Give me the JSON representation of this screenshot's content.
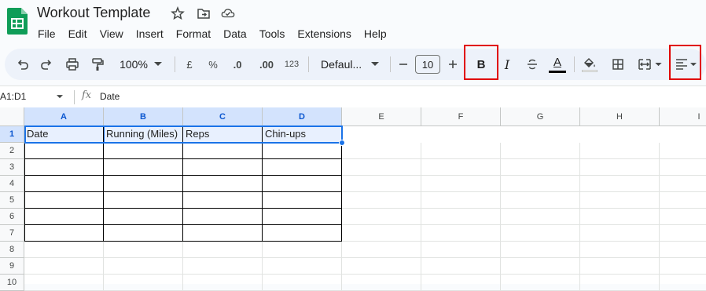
{
  "doc": {
    "title": "Workout Template"
  },
  "menu": [
    "File",
    "Edit",
    "View",
    "Insert",
    "Format",
    "Data",
    "Tools",
    "Extensions",
    "Help"
  ],
  "toolbar": {
    "zoom": "100%",
    "currency": "£",
    "percent": "%",
    "dec_decrease": ".0",
    "dec_increase": ".00",
    "number_format": "123",
    "font": "Defaul...",
    "font_size": "10",
    "bold": "B",
    "italic": "I",
    "text_color_letter": "A"
  },
  "formula_bar": {
    "name_box": "A1:D1",
    "fx": "fx",
    "value": "Date"
  },
  "sheet": {
    "columns": [
      "A",
      "B",
      "C",
      "D",
      "E",
      "F",
      "G",
      "H",
      "I"
    ],
    "rows": [
      "1",
      "2",
      "3",
      "4",
      "5",
      "6",
      "7",
      "8",
      "9",
      "10"
    ],
    "headers": [
      "Date",
      "Running (Miles)",
      "Reps",
      "Chin-ups"
    ]
  },
  "colors": {
    "accent": "#1a73e8",
    "highlight": "#e00000",
    "sheets_green": "#0f9d58"
  }
}
